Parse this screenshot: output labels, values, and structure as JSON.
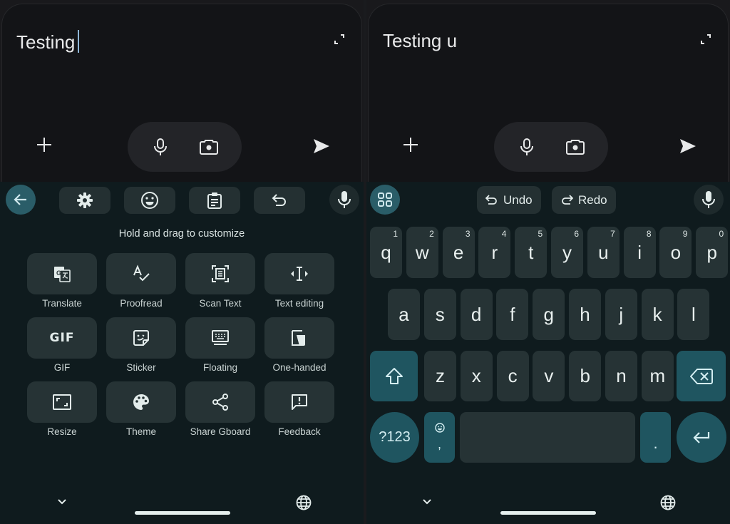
{
  "colors": {
    "keyboard_bg": "#0f1b1e",
    "key_bg": "#263335",
    "accent_key_bg": "#1f5560",
    "accent_circle": "#2a5d68",
    "app_bg": "#131417",
    "caret": "#8fb6d6"
  },
  "left_panel": {
    "app": {
      "message_text": "Testing",
      "icons": [
        "expand-icon",
        "add-icon",
        "microphone-icon",
        "camera-icon",
        "send-icon"
      ]
    },
    "toolbar": {
      "items": [
        {
          "icon": "back-arrow-icon"
        },
        {
          "icon": "settings-gear-icon"
        },
        {
          "icon": "emoji-icon"
        },
        {
          "icon": "clipboard-icon"
        },
        {
          "icon": "undo-icon"
        },
        {
          "icon": "microphone-icon"
        }
      ]
    },
    "hint": "Hold and drag to customize",
    "tiles": [
      {
        "label": "Translate",
        "icon": "translate-icon"
      },
      {
        "label": "Proofread",
        "icon": "proofread-icon"
      },
      {
        "label": "Scan Text",
        "icon": "scan-text-icon"
      },
      {
        "label": "Text editing",
        "icon": "text-editing-icon"
      },
      {
        "label": "GIF",
        "icon": "gif-icon",
        "glyph": "GIF"
      },
      {
        "label": "Sticker",
        "icon": "sticker-icon"
      },
      {
        "label": "Floating",
        "icon": "floating-keyboard-icon"
      },
      {
        "label": "One-handed",
        "icon": "one-handed-icon"
      },
      {
        "label": "Resize",
        "icon": "resize-icon"
      },
      {
        "label": "Theme",
        "icon": "palette-icon"
      },
      {
        "label": "Share Gboard",
        "icon": "share-icon"
      },
      {
        "label": "Feedback",
        "icon": "feedback-icon"
      }
    ],
    "nav": {
      "icons": [
        "hide-keyboard-chevron-icon",
        "globe-icon"
      ]
    }
  },
  "right_panel": {
    "app": {
      "message_text": "Testing u"
    },
    "toolbar": {
      "undo_label": "Undo",
      "redo_label": "Redo"
    },
    "rows": [
      [
        {
          "char": "q",
          "num": "1"
        },
        {
          "char": "w",
          "num": "2"
        },
        {
          "char": "e",
          "num": "3"
        },
        {
          "char": "r",
          "num": "4"
        },
        {
          "char": "t",
          "num": "5"
        },
        {
          "char": "y",
          "num": "6"
        },
        {
          "char": "u",
          "num": "7"
        },
        {
          "char": "i",
          "num": "8"
        },
        {
          "char": "o",
          "num": "9"
        },
        {
          "char": "p",
          "num": "0"
        }
      ],
      [
        {
          "char": "a"
        },
        {
          "char": "s"
        },
        {
          "char": "d"
        },
        {
          "char": "f"
        },
        {
          "char": "g"
        },
        {
          "char": "h"
        },
        {
          "char": "j"
        },
        {
          "char": "k"
        },
        {
          "char": "l"
        }
      ],
      [
        {
          "char": "z"
        },
        {
          "char": "x"
        },
        {
          "char": "c"
        },
        {
          "char": "v"
        },
        {
          "char": "b"
        },
        {
          "char": "n"
        },
        {
          "char": "m"
        }
      ]
    ],
    "symbols_label": "?123",
    "comma_label": ",",
    "period_label": ".",
    "space_label": ""
  }
}
